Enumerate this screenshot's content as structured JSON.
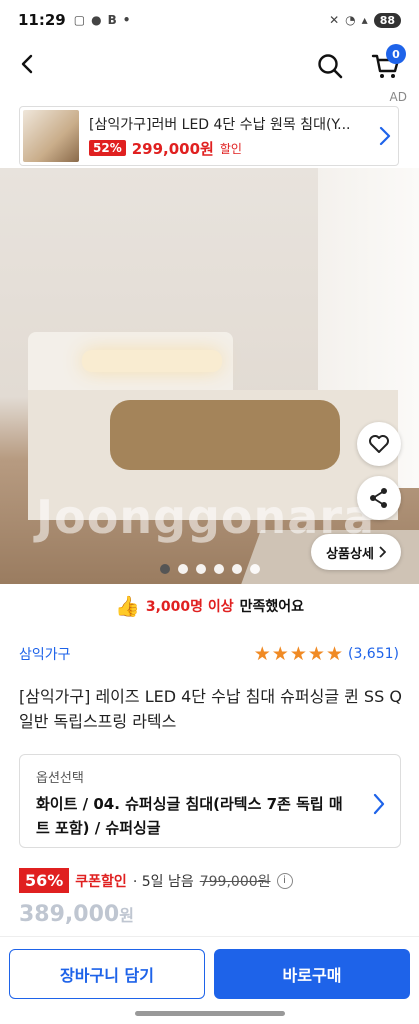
{
  "status": {
    "time": "11:29",
    "battery": "88"
  },
  "header": {
    "ad_label": "AD",
    "cart_count": "0"
  },
  "ad": {
    "title": "[삼익가구]러버 LED 4단 수납 원목 침대(Y...",
    "discount": "52%",
    "price": "299,000원",
    "sale": "할인"
  },
  "hero": {
    "watermark": "Joonggonara",
    "detail_label": "상품상세",
    "slide_count": 6,
    "active_slide": 0
  },
  "satisfaction": {
    "count": "3,000명 이상",
    "text": "만족했어요"
  },
  "product": {
    "brand": "삼익가구",
    "rating": 5,
    "review_count": "(3,651)",
    "title": "[삼익가구] 레이즈 LED 4단 수납 침대 슈퍼싱글 퀸 SS Q 일반 독립스프링 라텍스"
  },
  "option": {
    "label": "옵션선택",
    "value": "화이트 / 04. 슈퍼싱글 침대(라텍스 7존 독립 매트 포함) / 슈퍼싱글"
  },
  "pricing": {
    "discount_pct": "56%",
    "coupon": "쿠폰할인",
    "remaining": "· 5일 남음",
    "original": "799,000원",
    "final": "389,000",
    "won": "원"
  },
  "actions": {
    "cart_label": "장바구니 담기",
    "buy_label": "바로구매"
  },
  "colors": {
    "accent": "#1e63e9",
    "sale": "#e02020",
    "star": "#f08a24"
  }
}
